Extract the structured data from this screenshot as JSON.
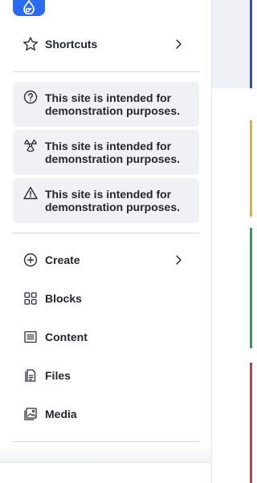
{
  "nav": {
    "shortcuts_label": "Shortcuts",
    "create_label": "Create",
    "blocks_label": "Blocks",
    "content_label": "Content",
    "files_label": "Files",
    "media_label": "Media"
  },
  "messages": [
    {
      "icon": "help-circle-icon",
      "text": "This site is intended for demonstration purposes."
    },
    {
      "icon": "radiation-icon",
      "text": "This site is intended for demonstration purposes."
    },
    {
      "icon": "warning-icon",
      "text": "This site is intended for demonstration purposes."
    }
  ],
  "colors": {
    "brand": "#2a6bf2",
    "message_bg": "#f0f1f5",
    "text": "#23262f",
    "accent_blue": "#2f4ad1",
    "accent_yellow": "#e2b21a",
    "accent_green": "#2e9e5b",
    "accent_red": "#d23a3a"
  }
}
